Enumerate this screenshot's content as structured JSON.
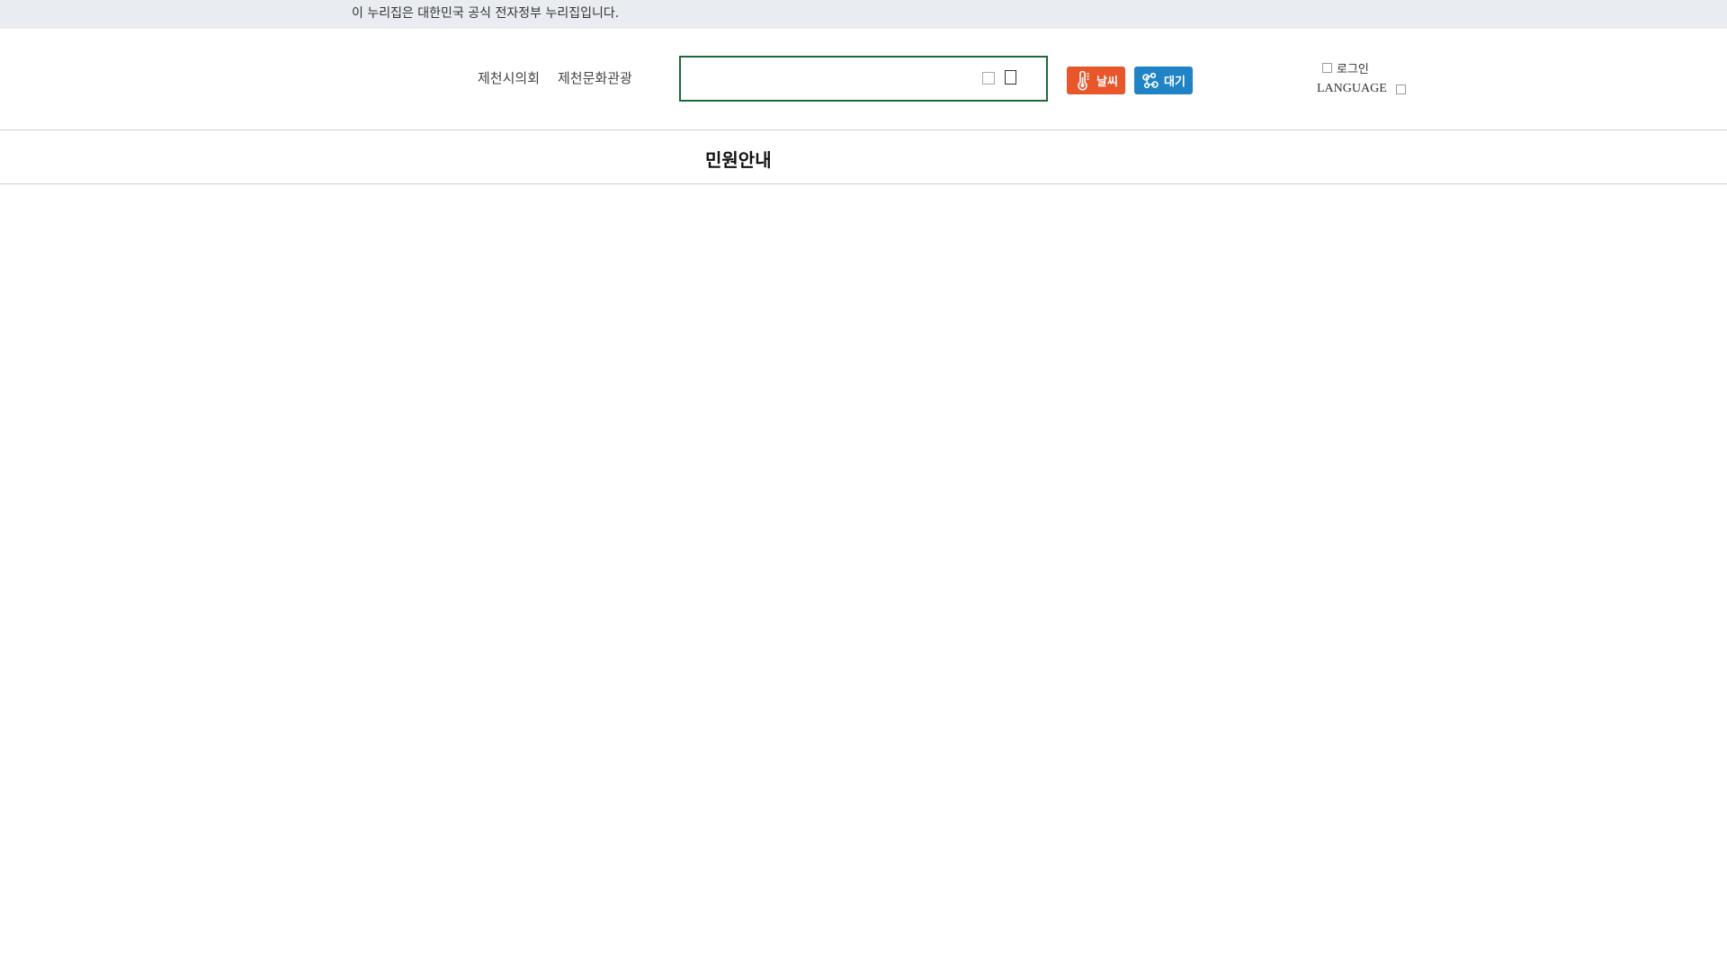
{
  "gov_banner": {
    "text": "이 누리집은 대한민국 공식 전자정부 누리집입니다."
  },
  "header": {
    "site_links": [
      "제천시의회",
      "제천문화관광"
    ],
    "search": {
      "placeholder": "",
      "value": ""
    },
    "weather_label": "날씨",
    "air_label": "대기",
    "login_label": "로그인",
    "language_label": "LANGUAGE"
  },
  "nav": {
    "items": [
      "민원안내"
    ]
  },
  "colors": {
    "search_border": "#1f6a3a",
    "weather": "#e8562a",
    "air": "#1f83c6",
    "banner_bg": "#e9ecf1"
  },
  "icons": {
    "weather": "thermometer-icon",
    "air": "molecule-icon",
    "search": "search-icon",
    "clear": "clear-icon",
    "login": "user-icon",
    "language": "chevron-down-icon"
  }
}
